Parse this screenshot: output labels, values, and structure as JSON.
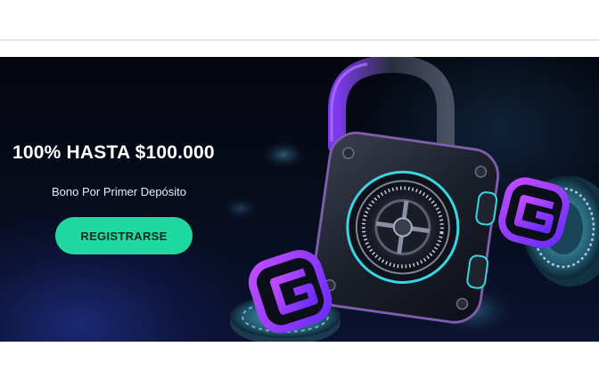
{
  "promo": {
    "title": "100% HASTA $100.000",
    "subtitle": "Bono Por Primer Depósito",
    "cta_label": "REGISTRARSE"
  },
  "colors": {
    "background_top": "#05070f",
    "background_bottom": "#0a1230",
    "cta": "#1fd9a0",
    "neon_purple": "#9b4dff",
    "neon_teal": "#39d5e6"
  },
  "icons": {
    "padlock": "padlock-safe-icon",
    "brand_coin": "brand-g-coin-icon",
    "casino_chip": "casino-chip-icon"
  }
}
